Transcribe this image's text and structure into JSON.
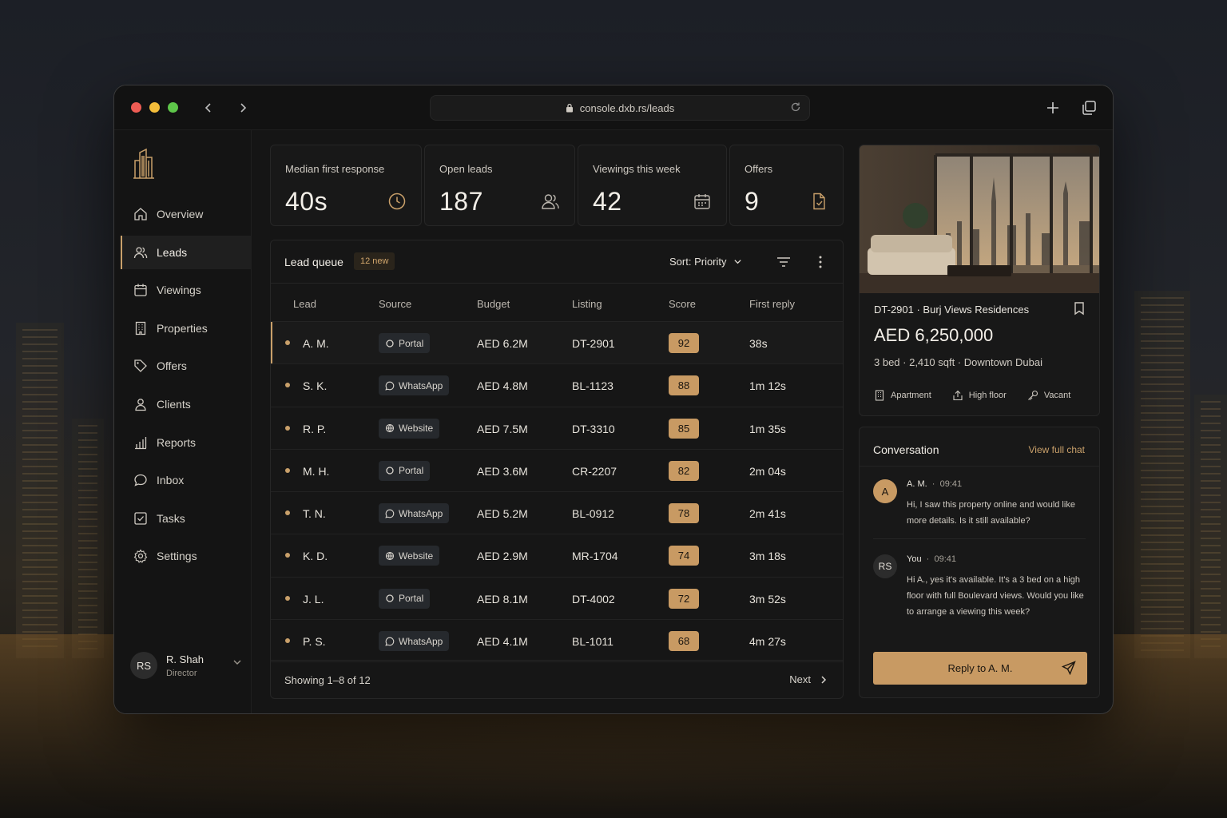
{
  "browser": {
    "url": "console.dxb.rs/leads"
  },
  "sidebar": {
    "items": [
      {
        "label": "Overview",
        "icon": "home-icon"
      },
      {
        "label": "Leads",
        "icon": "users-icon",
        "active": true
      },
      {
        "label": "Viewings",
        "icon": "calendar-icon"
      },
      {
        "label": "Properties",
        "icon": "building-icon"
      },
      {
        "label": "Offers",
        "icon": "tag-icon"
      },
      {
        "label": "Clients",
        "icon": "user-icon"
      },
      {
        "label": "Reports",
        "icon": "bar-chart-icon"
      },
      {
        "label": "Inbox",
        "icon": "chat-bubble-icon"
      },
      {
        "label": "Tasks",
        "icon": "checkbox-icon"
      },
      {
        "label": "Settings",
        "icon": "gear-icon"
      }
    ],
    "user": {
      "initials": "RS",
      "name": "R. Shah",
      "role": "Director"
    }
  },
  "stats": [
    {
      "label": "Median first response",
      "value": "40s",
      "icon": "clock-icon"
    },
    {
      "label": "Open leads",
      "value": "187",
      "icon": "users-icon"
    },
    {
      "label": "Viewings this week",
      "value": "42",
      "icon": "calendar-icon"
    },
    {
      "label": "Offers",
      "value": "9",
      "icon": "document-check-icon"
    }
  ],
  "queue": {
    "title": "Lead queue",
    "badge": "12 new",
    "sort_label": "Sort: Priority",
    "columns": {
      "lead": "Lead",
      "source": "Source",
      "budget": "Budget",
      "listing": "Listing",
      "score": "Score",
      "first_reply": "First reply"
    },
    "rows": [
      {
        "lead": "A. M.",
        "source": "Portal",
        "budget": "AED 6.2M",
        "listing": "DT-2901",
        "score": "92",
        "reply": "38s"
      },
      {
        "lead": "S. K.",
        "source": "WhatsApp",
        "budget": "AED 4.8M",
        "listing": "BL-1123",
        "score": "88",
        "reply": "1m 12s"
      },
      {
        "lead": "R. P.",
        "source": "Website",
        "budget": "AED 7.5M",
        "listing": "DT-3310",
        "score": "85",
        "reply": "1m 35s"
      },
      {
        "lead": "M. H.",
        "source": "Portal",
        "budget": "AED 3.6M",
        "listing": "CR-2207",
        "score": "82",
        "reply": "2m 04s"
      },
      {
        "lead": "T. N.",
        "source": "WhatsApp",
        "budget": "AED 5.2M",
        "listing": "BL-0912",
        "score": "78",
        "reply": "2m 41s"
      },
      {
        "lead": "K. D.",
        "source": "Website",
        "budget": "AED 2.9M",
        "listing": "MR-1704",
        "score": "74",
        "reply": "3m 18s"
      },
      {
        "lead": "J. L.",
        "source": "Portal",
        "budget": "AED 8.1M",
        "listing": "DT-4002",
        "score": "72",
        "reply": "3m 52s"
      },
      {
        "lead": "P. S.",
        "source": "WhatsApp",
        "budget": "AED 4.1M",
        "listing": "BL-1011",
        "score": "68",
        "reply": "4m 27s"
      }
    ],
    "footer": {
      "showing": "Showing  1–8 of 12",
      "next": "Next"
    }
  },
  "property": {
    "id_line": "DT-2901  ·  Burj Views Residences",
    "price": "AED 6,250,000",
    "meta": "3 bed  ·  2,410 sqft  ·  Downtown Dubai",
    "tags": [
      "Apartment",
      "High floor",
      "Vacant"
    ]
  },
  "conversation": {
    "title": "Conversation",
    "link": "View full chat",
    "messages": [
      {
        "initial": "A",
        "sender": "A. M.",
        "time": "09:41",
        "text": "Hi, I saw this property online and would like more details. Is it still available?"
      },
      {
        "initial": "RS",
        "sender": "You",
        "time": "09:41",
        "text": "Hi A., yes it's available. It's a 3 bed on a high floor with full Boulevard views. Would you like to arrange a viewing this week?"
      }
    ],
    "reply_button": "Reply to A. M."
  },
  "colors": {
    "accent": "#c89a63",
    "background": "#151515",
    "panel": "#181818"
  }
}
